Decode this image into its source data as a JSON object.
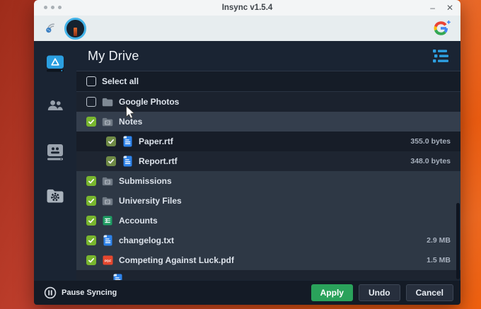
{
  "titlebar": {
    "title": "Insync v1.5.4",
    "minimize": "–",
    "close": "✕"
  },
  "header": {
    "title": "My Drive"
  },
  "sidebar": {
    "items": [
      {
        "id": "my-drive",
        "icon": "drive-icon",
        "active": true
      },
      {
        "id": "shared",
        "icon": "people-icon",
        "active": false
      },
      {
        "id": "contacts",
        "icon": "contact-card-icon",
        "active": false
      },
      {
        "id": "folder-settings",
        "icon": "folder-gear-icon",
        "active": false
      }
    ]
  },
  "list": {
    "select_all": "Select all",
    "rows": [
      {
        "label": "Google Photos",
        "icon": "folder",
        "checked": false,
        "indent": 0,
        "size": "",
        "shade": "mid"
      },
      {
        "label": "Notes",
        "icon": "folder-sync",
        "checked": true,
        "indent": 0,
        "size": "",
        "shade": "hover"
      },
      {
        "label": "Paper.rtf",
        "icon": "doc",
        "checked": true,
        "indent": 1,
        "size": "355.0 bytes",
        "shade": "dark",
        "child": true
      },
      {
        "label": "Report.rtf",
        "icon": "doc",
        "checked": true,
        "indent": 1,
        "size": "348.0 bytes",
        "shade": "mid2",
        "child": true
      },
      {
        "label": "Submissions",
        "icon": "folder-sync",
        "checked": true,
        "indent": 0,
        "size": "",
        "shade": "light"
      },
      {
        "label": "University Files",
        "icon": "folder-sync",
        "checked": true,
        "indent": 0,
        "size": "",
        "shade": "light"
      },
      {
        "label": "Accounts",
        "icon": "sheet",
        "checked": true,
        "indent": 0,
        "size": "",
        "shade": "light"
      },
      {
        "label": "changelog.txt",
        "icon": "doc",
        "checked": true,
        "indent": 0,
        "size": "2.9 MB",
        "shade": "light"
      },
      {
        "label": "Competing Against Luck.pdf",
        "icon": "pdf",
        "checked": true,
        "indent": 0,
        "size": "1.5 MB",
        "shade": "light"
      }
    ],
    "partial_row": {
      "icon": "doc"
    }
  },
  "footer": {
    "pause": "Pause Syncing",
    "apply": "Apply",
    "undo": "Undo",
    "cancel": "Cancel"
  },
  "icons": {
    "pdf_badge": "PDF"
  },
  "colors": {
    "accent_blue": "#2d9fe0",
    "check_green": "#79b62f",
    "child_check_green": "#6f8a46",
    "apply_green": "#2aa25b",
    "doc_blue": "#2e83ea",
    "sheet_green": "#1f9e63",
    "pdf_red": "#e5472e",
    "desktop_orange": "#e65812",
    "header_bg": "#1a2433",
    "row_highlight": "#2e3845"
  }
}
